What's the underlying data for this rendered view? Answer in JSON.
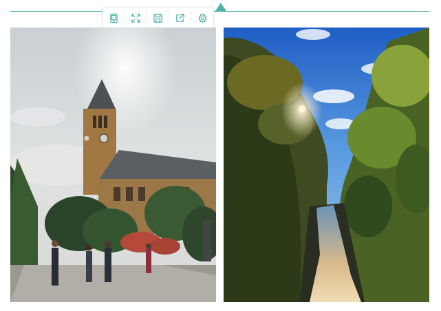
{
  "accent_color": "#4fb3a3",
  "toolbar": {
    "buttons": [
      {
        "name": "tablet-icon",
        "action": "device-view"
      },
      {
        "name": "fullscreen-icon",
        "action": "fullscreen"
      },
      {
        "name": "save-icon",
        "action": "save"
      },
      {
        "name": "share-icon",
        "action": "share"
      },
      {
        "name": "settings-icon",
        "action": "settings"
      }
    ]
  },
  "photos": [
    {
      "subject": "clock-tower-campus-photo"
    },
    {
      "subject": "gorge-waterfall-autumn-photo"
    }
  ]
}
